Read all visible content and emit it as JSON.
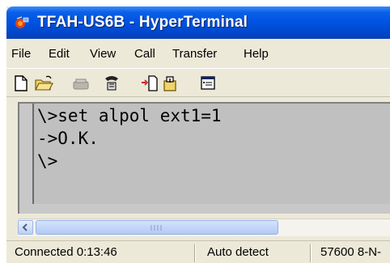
{
  "window": {
    "title": "TFAH-US6B - HyperTerminal",
    "icon": "hyperterminal-app-icon"
  },
  "menu": {
    "items": [
      "File",
      "Edit",
      "View",
      "Call",
      "Transfer",
      "Help"
    ]
  },
  "toolbar": {
    "icons": [
      "new-document-icon",
      "open-folder-icon",
      "disconnect-icon",
      "dial-icon",
      "send-file-icon",
      "receive-file-icon",
      "properties-icon"
    ]
  },
  "terminal": {
    "lines": [
      "\\>set alpol ext1=1",
      "->O.K.",
      "\\>"
    ]
  },
  "statusbar": {
    "connection": "Connected 0:13:46",
    "detect": "Auto detect",
    "settings": "57600 8-N-"
  },
  "colors": {
    "titlebar": "#0054e3",
    "chrome": "#ece9d8",
    "terminal_bg": "#c0c0c0",
    "scroll_thumb": "#c2d6f8"
  }
}
